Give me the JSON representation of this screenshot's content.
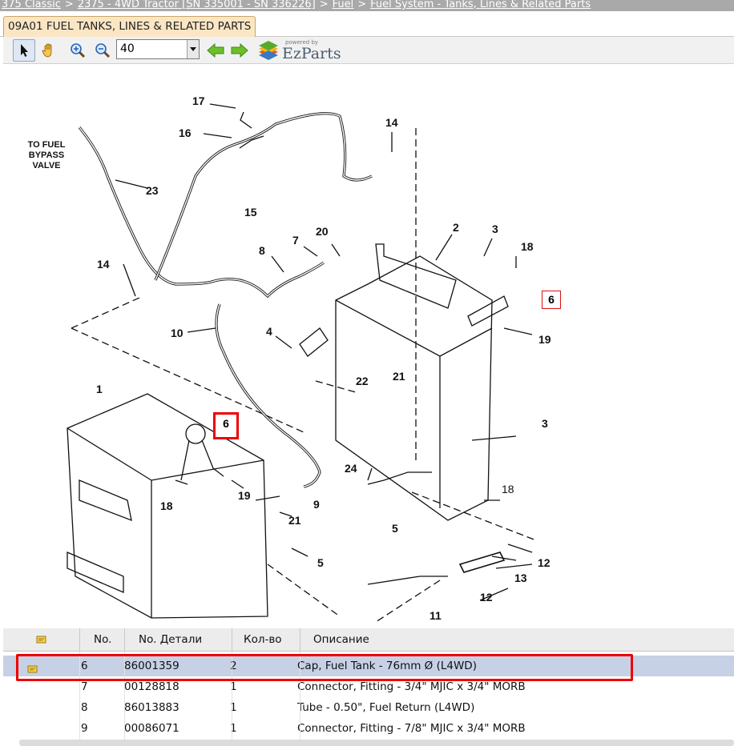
{
  "breadcrumb": {
    "items": [
      "375 Classic",
      "2375 - 4WD Tractor [SN 335001 - SN 336226]",
      "Fuel",
      "Fuel System - Tanks, Lines & Related Parts"
    ],
    "separator": ">"
  },
  "tab": {
    "label": "09A01 FUEL TANKS, LINES & RELATED PARTS"
  },
  "toolbar": {
    "zoom_value": "40",
    "logo_powered": "powered by",
    "logo_name": "EzParts"
  },
  "drawing": {
    "note": "TO FUEL\nBYPASS\nVALVE",
    "labels": [
      "17",
      "16",
      "14",
      "23",
      "15",
      "14",
      "2",
      "3",
      "18",
      "7",
      "20",
      "8",
      "10",
      "4",
      "22",
      "21",
      "19",
      "1",
      "3",
      "24",
      "18",
      "9",
      "21",
      "5",
      "19",
      "18",
      "5",
      "12",
      "13",
      "12",
      "11"
    ],
    "callouts": [
      "6",
      "6"
    ]
  },
  "table": {
    "columns": [
      "No.",
      "No. Детали",
      "Кол-во",
      "Описание"
    ],
    "rows": [
      {
        "no": "6",
        "part": "86001359",
        "qty": "2",
        "desc": "Cap, Fuel Tank - 76mm Ø (L4WD)",
        "selected": true
      },
      {
        "no": "7",
        "part": "00128818",
        "qty": "1",
        "desc": "Connector, Fitting - 3/4\" MJIC x 3/4\" MORB",
        "selected": false
      },
      {
        "no": "8",
        "part": "86013883",
        "qty": "1",
        "desc": "Tube - 0.50\", Fuel Return (L4WD)",
        "selected": false
      },
      {
        "no": "9",
        "part": "00086071",
        "qty": "1",
        "desc": "Connector, Fitting - 7/8\" MJIC x 3/4\" MORB",
        "selected": false
      }
    ]
  },
  "colors": {
    "breadcrumb_bg": "#a9a9a9",
    "tab_bg": "#fbe6c4",
    "selected_row": "#c6d1e6",
    "highlight_red": "#e00000",
    "arrow_green": "#6cbf2a"
  },
  "icons": [
    "pointer-icon",
    "hand-icon",
    "zoom-in-icon",
    "zoom-out-icon",
    "dropdown-arrow-icon",
    "back-arrow-icon",
    "forward-arrow-icon",
    "ezparts-logo-icon",
    "notes-icon"
  ]
}
